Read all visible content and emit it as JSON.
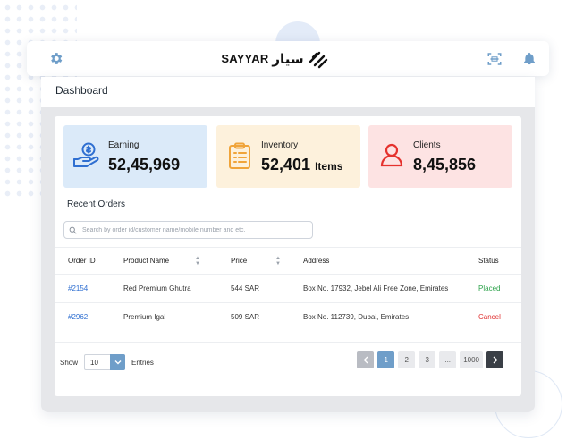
{
  "brand": {
    "name_en": "SAYYAR",
    "name_ar": "سيار"
  },
  "header": {
    "settings_icon": "gear-icon",
    "scan_icon": "scan-icon",
    "notification_icon": "bell-icon"
  },
  "dashboard": {
    "title": "Dashboard"
  },
  "stats": [
    {
      "label": "Earning",
      "value": "52,45,969",
      "unit": "",
      "icon": "hand-coin-icon",
      "bg": "#dbeaf9",
      "accent": "#2f6fd1"
    },
    {
      "label": "Inventory",
      "value": "52,401",
      "unit": "Items",
      "icon": "clipboard-list-icon",
      "bg": "#fdf1dc",
      "accent": "#f0a43a"
    },
    {
      "label": "Clients",
      "value": "8,45,856",
      "unit": "",
      "icon": "user-icon",
      "bg": "#fde3e3",
      "accent": "#e5322e"
    }
  ],
  "orders": {
    "section_title": "Recent Orders",
    "search_placeholder": "Search by order id/customer name/mobile number and etc.",
    "columns": [
      "Order ID",
      "Product Name",
      "Price",
      "Address",
      "Status"
    ],
    "rows": [
      {
        "order_id": "#2154",
        "product": "Red Premium Ghutra",
        "price": "544 SAR",
        "address": "Box No. 17932, Jebel Ali Free Zone, Emirates",
        "status": "Placed",
        "status_color": "#2ca24a"
      },
      {
        "order_id": "#2962",
        "product": "Premium Igal",
        "price": "509 SAR",
        "address": "Box No. 112739, Dubai, Emirates",
        "status": "Cancel",
        "status_color": "#e03131"
      }
    ]
  },
  "pagination": {
    "show_label": "Show",
    "entries_value": "10",
    "entries_label": "Entries",
    "pages": [
      "1",
      "2",
      "3",
      "...",
      "1000"
    ],
    "active_page": "1"
  },
  "colors": {
    "accent": "#6f9ec9",
    "link": "#2f6fd1"
  }
}
